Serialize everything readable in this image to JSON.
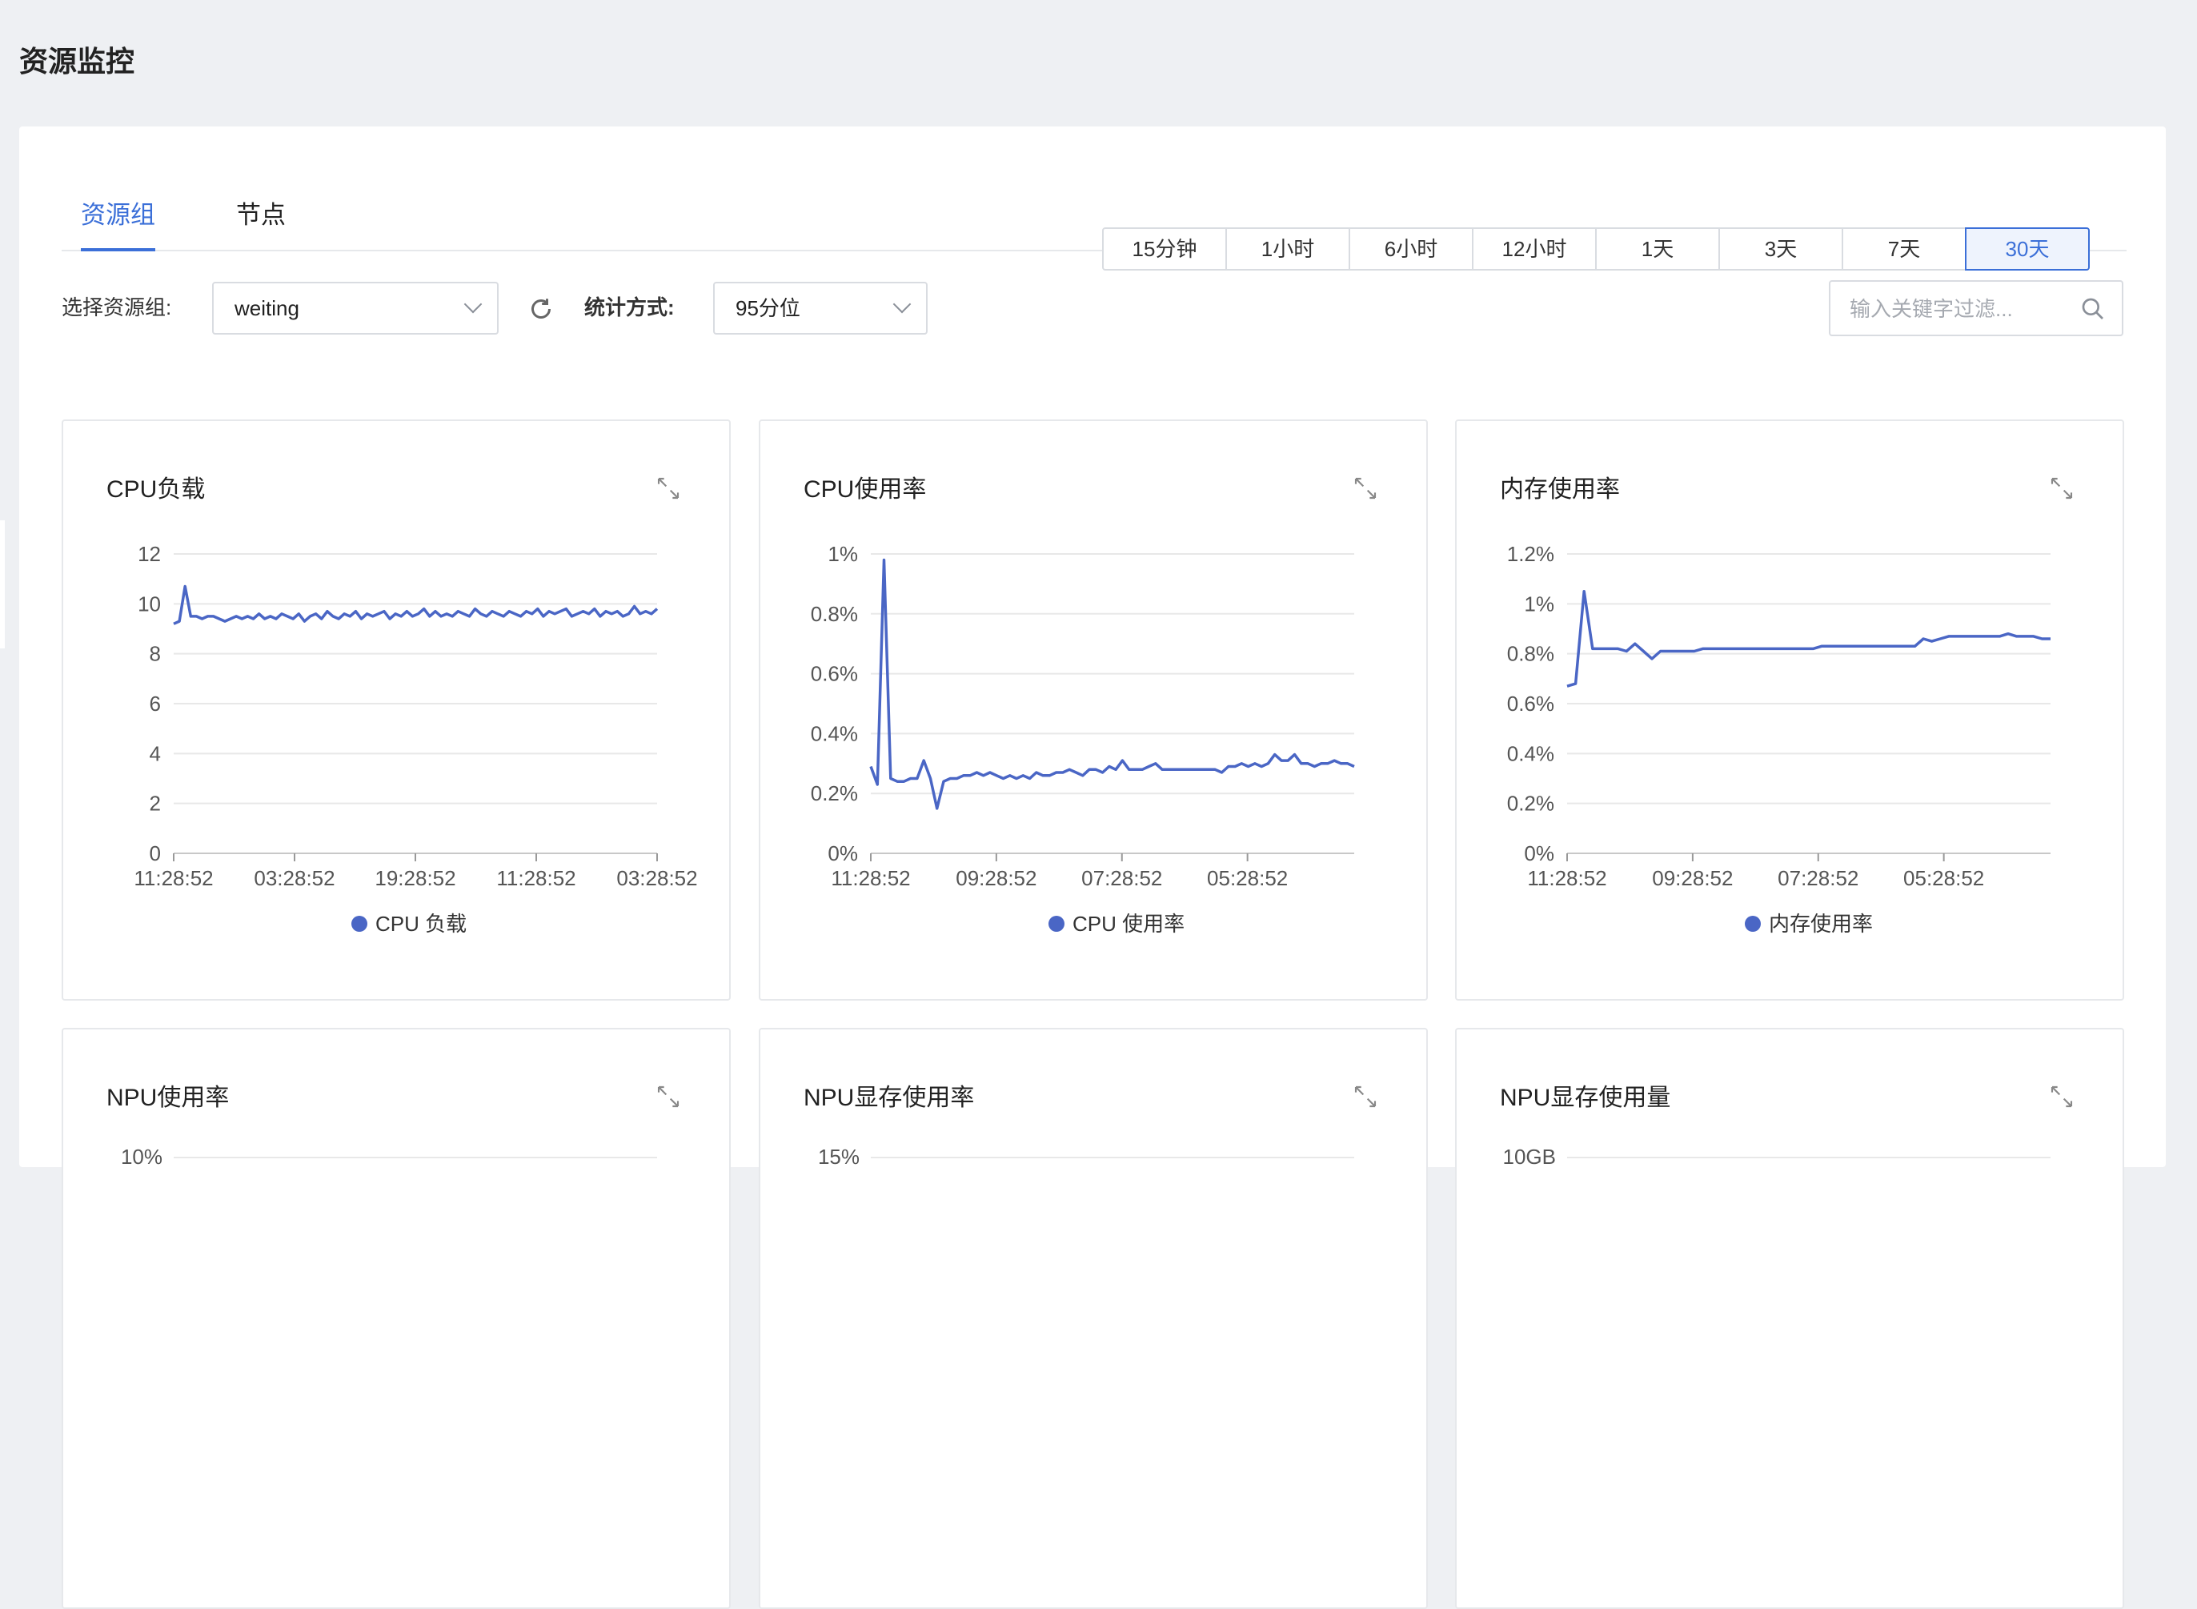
{
  "page": {
    "title": "资源监控"
  },
  "tabs": [
    {
      "label": "资源组",
      "active": true
    },
    {
      "label": "节点",
      "active": false
    }
  ],
  "filters": {
    "group_label": "选择资源组:",
    "group_value": "weiting",
    "stat_label": "统计方式:",
    "stat_value": "95分位",
    "search_placeholder": "输入关键字过滤..."
  },
  "time_ranges": [
    {
      "label": "15分钟",
      "active": false
    },
    {
      "label": "1小时",
      "active": false
    },
    {
      "label": "6小时",
      "active": false
    },
    {
      "label": "12小时",
      "active": false
    },
    {
      "label": "1天",
      "active": false
    },
    {
      "label": "3天",
      "active": false
    },
    {
      "label": "7天",
      "active": false
    },
    {
      "label": "30天",
      "active": true
    }
  ],
  "colors": {
    "accent": "#3b6fd8",
    "series": "#4a66c5",
    "grid": "#e8e8e8"
  },
  "icons": {
    "refresh": "refresh-icon",
    "search": "search-icon",
    "expand": "expand-icon",
    "dropdown": "chevron-down-icon"
  },
  "chart_data": [
    {
      "type": "line",
      "title": "CPU负载",
      "yticks": [
        "0",
        "2",
        "4",
        "6",
        "8",
        "10",
        "12"
      ],
      "ylim": [
        0,
        12
      ],
      "xticks": [
        "11:28:52",
        "03:28:52",
        "19:28:52",
        "11:28:52",
        "03:28:52"
      ],
      "legend": "CPU 负载",
      "series": [
        {
          "values": [
            9.2,
            9.3,
            10.7,
            9.5,
            9.5,
            9.4,
            9.5,
            9.5,
            9.4,
            9.3,
            9.4,
            9.5,
            9.4,
            9.5,
            9.4,
            9.6,
            9.4,
            9.5,
            9.4,
            9.6,
            9.5,
            9.4,
            9.6,
            9.3,
            9.5,
            9.6,
            9.4,
            9.7,
            9.5,
            9.4,
            9.6,
            9.5,
            9.7,
            9.4,
            9.6,
            9.5,
            9.6,
            9.7,
            9.4,
            9.6,
            9.5,
            9.7,
            9.5,
            9.6,
            9.8,
            9.5,
            9.7,
            9.5,
            9.6,
            9.5,
            9.7,
            9.6,
            9.5,
            9.8,
            9.6,
            9.5,
            9.7,
            9.6,
            9.5,
            9.7,
            9.6,
            9.5,
            9.7,
            9.6,
            9.8,
            9.5,
            9.7,
            9.6,
            9.7,
            9.8,
            9.5,
            9.6,
            9.7,
            9.6,
            9.8,
            9.5,
            9.7,
            9.6,
            9.7,
            9.5,
            9.6,
            9.9,
            9.6,
            9.7,
            9.6,
            9.8
          ]
        }
      ]
    },
    {
      "type": "line",
      "title": "CPU使用率",
      "yticks": [
        "0%",
        "0.2%",
        "0.4%",
        "0.6%",
        "0.8%",
        "1%"
      ],
      "ylim": [
        0,
        1
      ],
      "xticks": [
        "11:28:52",
        "09:28:52",
        "07:28:52",
        "05:28:52"
      ],
      "legend": "CPU 使用率",
      "series": [
        {
          "values": [
            0.29,
            0.23,
            0.98,
            0.25,
            0.24,
            0.24,
            0.25,
            0.25,
            0.31,
            0.25,
            0.15,
            0.24,
            0.25,
            0.25,
            0.26,
            0.26,
            0.27,
            0.26,
            0.27,
            0.26,
            0.25,
            0.26,
            0.25,
            0.26,
            0.25,
            0.27,
            0.26,
            0.26,
            0.27,
            0.27,
            0.28,
            0.27,
            0.26,
            0.28,
            0.28,
            0.27,
            0.29,
            0.28,
            0.31,
            0.28,
            0.28,
            0.28,
            0.29,
            0.3,
            0.28,
            0.28,
            0.28,
            0.28,
            0.28,
            0.28,
            0.28,
            0.28,
            0.28,
            0.27,
            0.29,
            0.29,
            0.3,
            0.29,
            0.3,
            0.29,
            0.3,
            0.33,
            0.31,
            0.31,
            0.33,
            0.3,
            0.3,
            0.29,
            0.3,
            0.3,
            0.31,
            0.3,
            0.3,
            0.29
          ]
        }
      ]
    },
    {
      "type": "line",
      "title": "内存使用率",
      "yticks": [
        "0%",
        "0.2%",
        "0.4%",
        "0.6%",
        "0.8%",
        "1%",
        "1.2%"
      ],
      "ylim": [
        0,
        1.2
      ],
      "xticks": [
        "11:28:52",
        "09:28:52",
        "07:28:52",
        "05:28:52"
      ],
      "legend": "内存使用率",
      "series": [
        {
          "values": [
            0.67,
            0.68,
            1.05,
            0.82,
            0.82,
            0.82,
            0.82,
            0.81,
            0.84,
            0.81,
            0.78,
            0.81,
            0.81,
            0.81,
            0.81,
            0.81,
            0.82,
            0.82,
            0.82,
            0.82,
            0.82,
            0.82,
            0.82,
            0.82,
            0.82,
            0.82,
            0.82,
            0.82,
            0.82,
            0.82,
            0.83,
            0.83,
            0.83,
            0.83,
            0.83,
            0.83,
            0.83,
            0.83,
            0.83,
            0.83,
            0.83,
            0.83,
            0.86,
            0.85,
            0.86,
            0.87,
            0.87,
            0.87,
            0.87,
            0.87,
            0.87,
            0.87,
            0.88,
            0.87,
            0.87,
            0.87,
            0.86,
            0.86
          ]
        }
      ]
    },
    {
      "type": "line",
      "title": "NPU使用率",
      "yticks": [
        "10%"
      ]
    },
    {
      "type": "line",
      "title": "NPU显存使用率",
      "yticks": [
        "15%"
      ]
    },
    {
      "type": "line",
      "title": "NPU显存使用量",
      "yticks": [
        "10GB"
      ]
    }
  ]
}
